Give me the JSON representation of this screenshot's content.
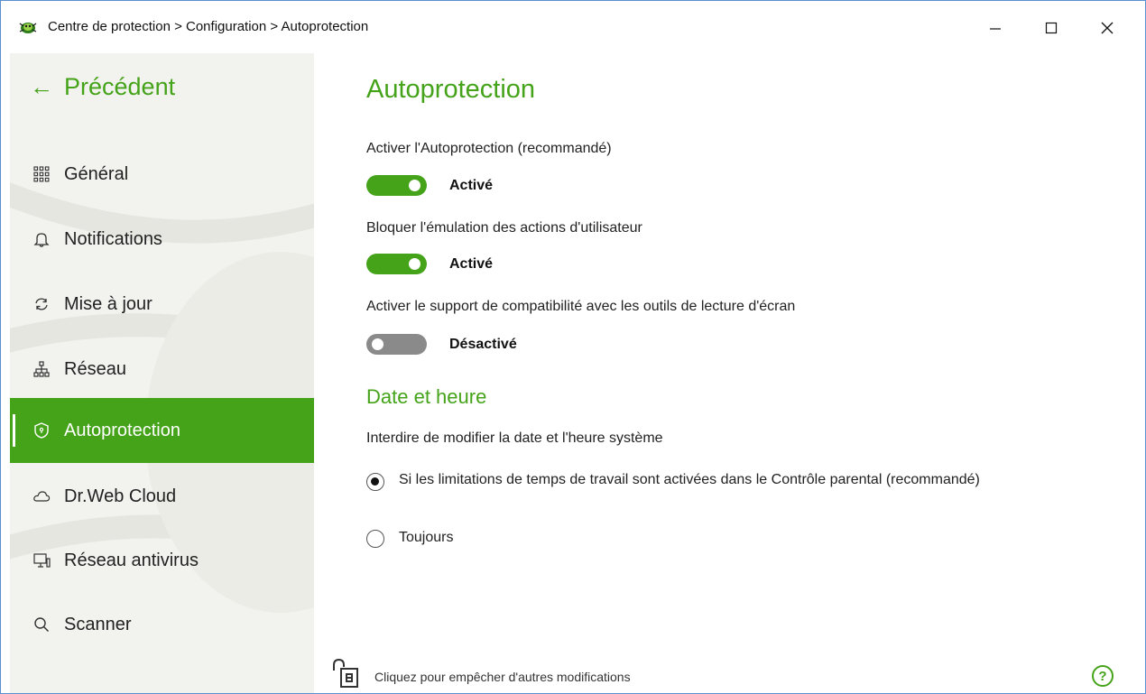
{
  "window": {
    "title": "Centre de protection > Configuration > Autoprotection",
    "controls": {
      "minimize": "—",
      "maximize": "☐",
      "close": "✕"
    }
  },
  "sidebar": {
    "back_label": "Précédent",
    "back_arrow": "←",
    "items": [
      {
        "label": "Général",
        "icon": "grid-icon"
      },
      {
        "label": "Notifications",
        "icon": "bell-icon"
      },
      {
        "label": "Mise à jour",
        "icon": "refresh-icon"
      },
      {
        "label": "Réseau",
        "icon": "network-icon"
      },
      {
        "label": "Autoprotection",
        "icon": "shield-icon",
        "active": true
      },
      {
        "label": "Dr.Web Cloud",
        "icon": "cloud-icon"
      },
      {
        "label": "Réseau antivirus",
        "icon": "monitor-icon"
      },
      {
        "label": "Scanner",
        "icon": "search-icon"
      }
    ]
  },
  "main": {
    "title": "Autoprotection",
    "settings": [
      {
        "label": "Activer l'Autoprotection (recommandé)",
        "state": "Activé",
        "on": true
      },
      {
        "label": "Bloquer l'émulation des actions d'utilisateur",
        "state": "Activé",
        "on": true
      },
      {
        "label": "Activer le support de compatibilité avec les outils de lecture d'écran",
        "state": "Désactivé",
        "on": false
      }
    ],
    "date_section": {
      "title": "Date et heure",
      "label": "Interdire de modifier la date et l'heure système",
      "options": [
        {
          "label": "Si les limitations de temps de travail sont activées dans le Contrôle parental (recommandé)",
          "checked": true
        },
        {
          "label": "Toujours",
          "checked": false
        }
      ]
    },
    "footer": {
      "lock_text": "Cliquez pour empêcher d'autres modifications",
      "help_label": "?"
    }
  },
  "colors": {
    "accent": "#45a31a",
    "sidebar_bg": "#f2f2ef",
    "toggle_off": "#8a8a8a"
  }
}
